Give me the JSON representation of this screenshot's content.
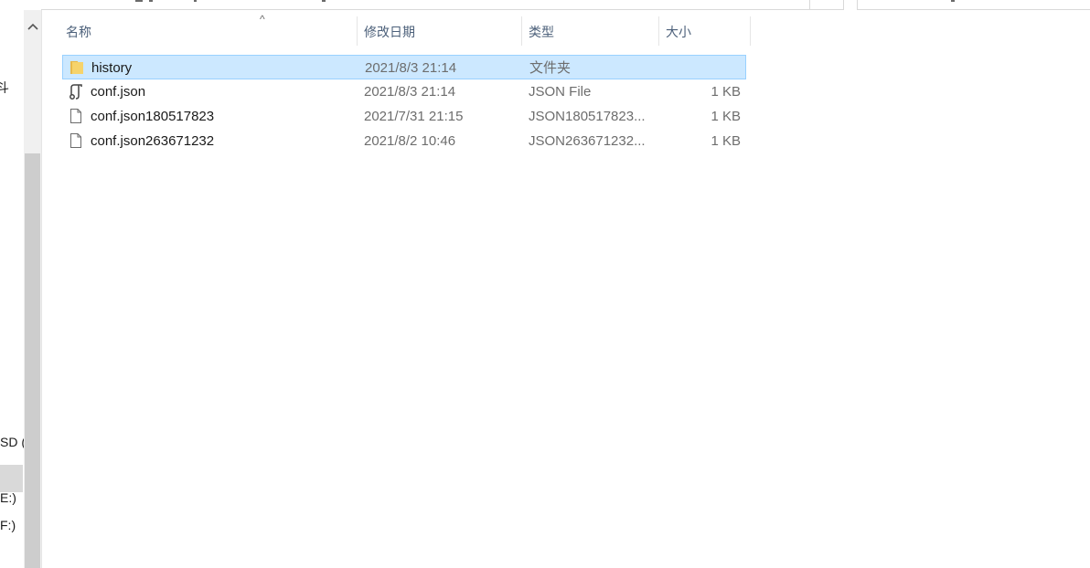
{
  "nav": {
    "items": [
      {
        "label": "斗"
      },
      {
        "label": "SD ("
      },
      {
        "label": "E:)"
      },
      {
        "label": "F:)"
      }
    ]
  },
  "list": {
    "columns": {
      "name": "名称",
      "date": "修改日期",
      "type": "类型",
      "size": "大小"
    },
    "sort_indicator": "^",
    "rows": [
      {
        "icon": "folder-icon",
        "name": "history",
        "date": "2021/8/3 21:14",
        "type": "文件夹",
        "size": "",
        "selected": true
      },
      {
        "icon": "json-file-icon",
        "name": "conf.json",
        "date": "2021/8/3 21:14",
        "type": "JSON File",
        "size": "1 KB",
        "selected": false
      },
      {
        "icon": "file-icon",
        "name": "conf.json180517823",
        "date": "2021/7/31 21:15",
        "type": "JSON180517823...",
        "size": "1 KB",
        "selected": false
      },
      {
        "icon": "file-icon",
        "name": "conf.json263671232",
        "date": "2021/8/2 10:46",
        "type": "JSON263671232...",
        "size": "1 KB",
        "selected": false
      }
    ]
  },
  "colors": {
    "selection_bg": "#cce8ff",
    "selection_border": "#99d1ff",
    "header_text": "#4c607a",
    "folder": "#f2c94c"
  }
}
